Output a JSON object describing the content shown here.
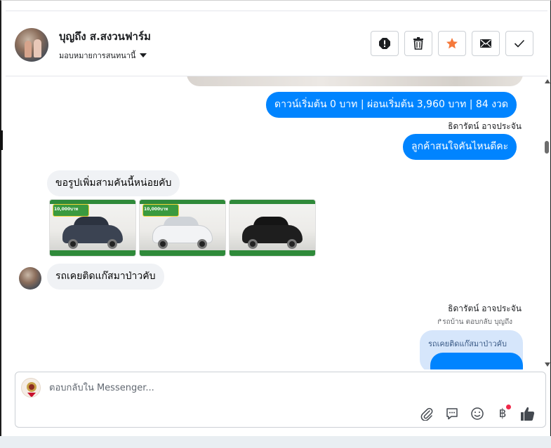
{
  "header": {
    "page_name": "บุญถึง ส.สงวนฟาร์ม",
    "assign_label": "มอบหมายการสนทนานี้",
    "actions": [
      {
        "name": "alert-icon"
      },
      {
        "name": "trash-icon"
      },
      {
        "name": "star-icon"
      },
      {
        "name": "envelope-icon"
      },
      {
        "name": "check-icon"
      }
    ]
  },
  "messages": {
    "m1": "ดาวน์เริ่มต้น 0 บาท | ผ่อนเริ่มต้น 3,960 บาท | 84 งวด",
    "sender1": "ธิดารัตน์ อาจประจัน",
    "m2": "ลูกค้าสนใจคันไหนดีคะ",
    "m3": "ขอรูปเพิ่มสามคันนี้หน่อยคับ",
    "m4": "รถเคยติดแก๊สมาป่าวคับ",
    "sender2": "ธิดารัตน์ อาจประจัน",
    "reply_note": "รถบ้าน ตอบกลับ บุญถึง",
    "quoted": "รถเคยติดแก๊สมาป่าวคับ",
    "thumb_promo": "10,000บาท"
  },
  "composer": {
    "placeholder": "ตอบกลับใน Messenger...",
    "baht_symbol": "฿"
  },
  "colors": {
    "outgoing": "#0084ff",
    "incoming": "#f0f2f5",
    "star": "#f5793b",
    "like": "#444950"
  }
}
